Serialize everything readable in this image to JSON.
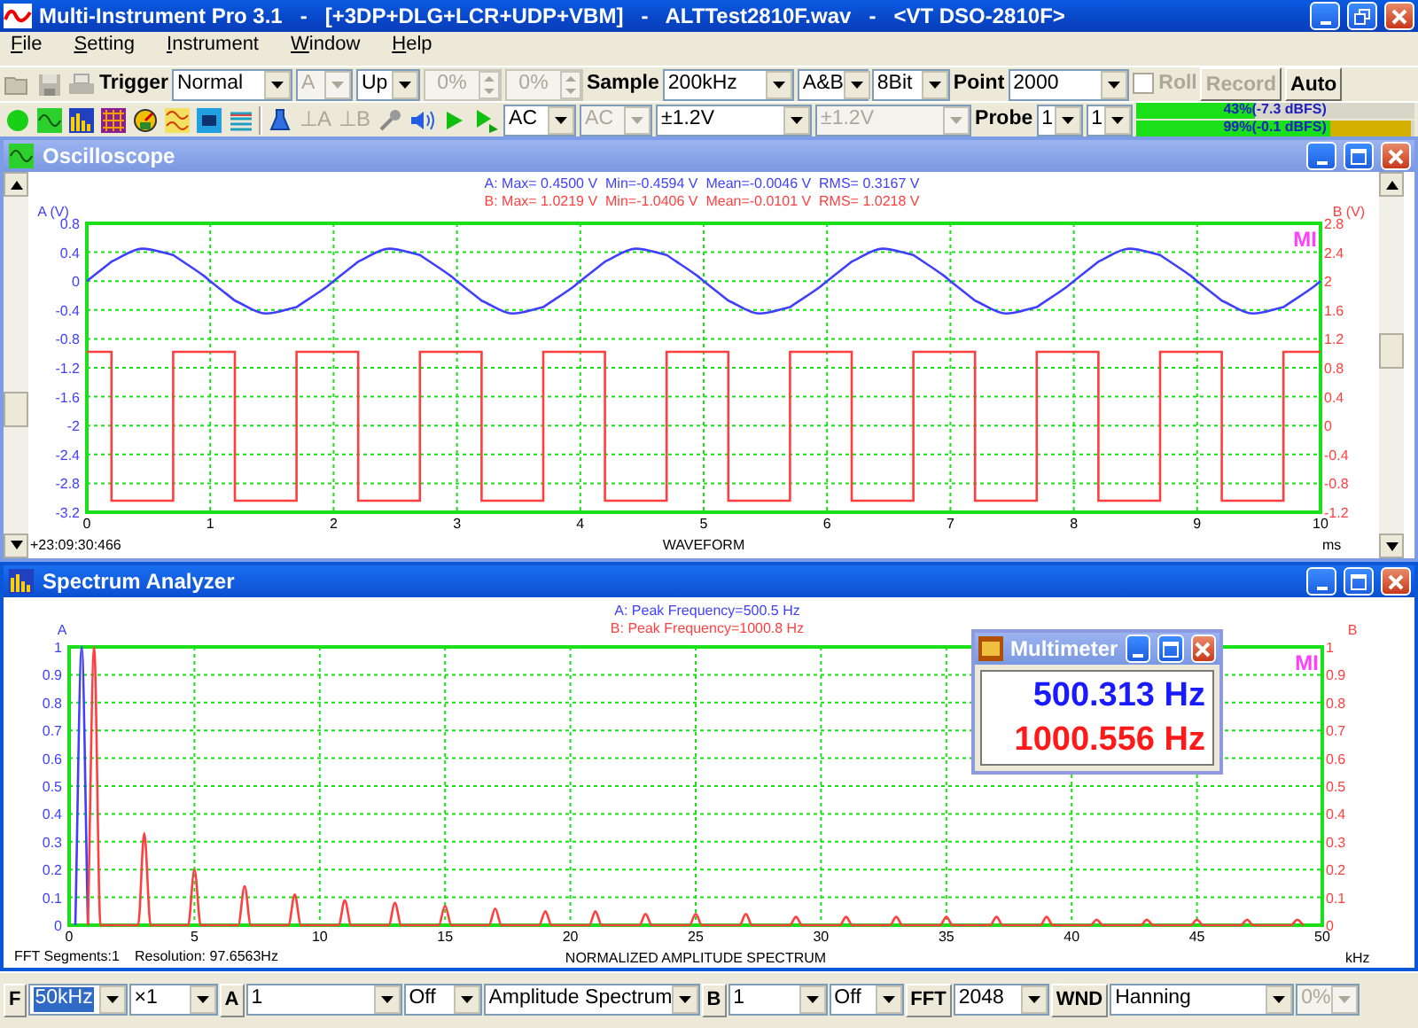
{
  "window": {
    "title": "Multi-Instrument Pro 3.1   -   [+3DP+DLG+LCR+UDP+VBM]   -   ALTTest2810F.wav   -   <VT DSO-2810F>"
  },
  "menu": [
    "File",
    "Setting",
    "Instrument",
    "Window",
    "Help"
  ],
  "toolbar_1": [
    {
      "kind": "label",
      "text": "Trigger"
    },
    {
      "kind": "dropdown",
      "text": "Normal",
      "disabled": false
    },
    {
      "kind": "dropdown",
      "text": "A",
      "disabled": true
    },
    {
      "kind": "dropdown",
      "text": "Up",
      "disabled": false
    },
    {
      "kind": "spin",
      "text": "0%",
      "disabled": true
    },
    {
      "kind": "spin",
      "text": "0%",
      "disabled": true
    },
    {
      "kind": "label",
      "text": "Sample"
    },
    {
      "kind": "dropdown",
      "text": "200kHz",
      "disabled": false
    },
    {
      "kind": "dropdown",
      "text": "A&B",
      "disabled": false
    },
    {
      "kind": "dropdown",
      "text": "8Bit",
      "disabled": false
    },
    {
      "kind": "label",
      "text": "Point"
    },
    {
      "kind": "dropdown",
      "text": "2000",
      "disabled": false
    },
    {
      "kind": "checkbox",
      "text": "Roll",
      "checked": false,
      "disabled": true
    },
    {
      "kind": "button",
      "text": "Record",
      "disabled": true
    },
    {
      "kind": "button",
      "text": "Auto",
      "disabled": false
    }
  ],
  "marker_buttons": [
    {
      "text": "⊥A",
      "disabled": true
    },
    {
      "text": "⊥B",
      "disabled": true
    }
  ],
  "toolbar_2": [
    {
      "kind": "dropdown",
      "text": "AC",
      "disabled": false
    },
    {
      "kind": "dropdown",
      "text": "AC",
      "disabled": true
    },
    {
      "kind": "dropdown",
      "text": "±1.2V",
      "disabled": false
    },
    {
      "kind": "dropdown",
      "text": "±1.2V",
      "disabled": true
    },
    {
      "kind": "label",
      "text": "Probe"
    },
    {
      "kind": "dropdown",
      "text": "1",
      "disabled": false
    },
    {
      "kind": "dropdown",
      "text": "1",
      "disabled": false
    },
    {
      "kind": "meters",
      "meters": [
        {
          "level": 0.43,
          "reading": "43%(-7.3 dBFS)"
        },
        {
          "level": 0.99,
          "reading": "99%(-0.1 dBFS)"
        }
      ]
    }
  ],
  "oscilloscope": {
    "title": "Oscilloscope",
    "active": false,
    "readouts": [
      {
        "text": "A: Max= 0.4500 V  Min=-0.4594 V  Mean=-0.0046 V  RMS= 0.3167 V",
        "color": "#3f3fff"
      },
      {
        "text": "B: Max= 1.0219 V  Min=-1.0406 V  Mean=-0.0101 V  RMS= 1.0218 V",
        "color": "#ff3f3f"
      }
    ],
    "timestamp": "+23:09:30:466",
    "logo": "MI",
    "x_unit": "ms",
    "chart_data": {
      "type": "line",
      "grid": true,
      "xlabel": "WAVEFORM",
      "ylabel": "A (V)",
      "y2label": "B (V)",
      "xlim": [
        0,
        10
      ],
      "ylim": [
        -3.2,
        0.8
      ],
      "y2lim": [
        -1.2,
        2.8
      ],
      "xticks": [
        0,
        1,
        2,
        3,
        4,
        5,
        6,
        7,
        8,
        9,
        10
      ],
      "yticks": [
        0.8,
        0.4,
        0,
        -0.4,
        -0.8,
        -1.2,
        -1.6,
        -2,
        -2.4,
        -2.8,
        -3.2
      ],
      "y2ticks": [
        2.8,
        2.4,
        2,
        1.6,
        1.2,
        0.8,
        0.4,
        0,
        -0.4,
        -0.8,
        -1.2
      ],
      "x": [
        0,
        0.2,
        0.2,
        0.45,
        0.7,
        0.7,
        0.95,
        1,
        1.2,
        1.2,
        1.45,
        1.7,
        1.7,
        1.95,
        2,
        2.2,
        2.2,
        2.45,
        2.7,
        2.7,
        2.95,
        3,
        3.2,
        3.2,
        3.45,
        3.7,
        3.7,
        3.95,
        4,
        4.2,
        4.2,
        4.45,
        4.7,
        4.7,
        4.95,
        5,
        5.2,
        5.2,
        5.45,
        5.7,
        5.7,
        5.95,
        6,
        6.2,
        6.2,
        6.45,
        6.7,
        6.7,
        6.95,
        7,
        7.2,
        7.2,
        7.45,
        7.7,
        7.7,
        7.95,
        8,
        8.2,
        8.2,
        8.45,
        8.7,
        8.7,
        8.95,
        9,
        9.2,
        9.2,
        9.45,
        9.7,
        9.7,
        9.95,
        10
      ],
      "series": [
        {
          "color": "#3f3fff",
          "values": [
            0,
            0.27,
            0.27,
            0.45,
            0.36,
            0.36,
            0.07,
            0,
            -0.27,
            -0.27,
            -0.45,
            -0.36,
            -0.36,
            -0.07,
            0,
            0.27,
            0.27,
            0.45,
            0.36,
            0.36,
            0.07,
            0,
            -0.27,
            -0.27,
            -0.45,
            -0.36,
            -0.36,
            -0.07,
            0,
            0.27,
            0.27,
            0.45,
            0.36,
            0.36,
            0.07,
            0,
            -0.27,
            -0.27,
            -0.45,
            -0.36,
            -0.36,
            -0.07,
            0,
            0.27,
            0.27,
            0.45,
            0.36,
            0.36,
            0.07,
            0,
            -0.27,
            -0.27,
            -0.45,
            -0.36,
            -0.36,
            -0.07,
            0,
            0.27,
            0.27,
            0.45,
            0.36,
            0.36,
            0.07,
            0,
            -0.27,
            -0.27,
            -0.45,
            -0.36,
            -0.36,
            -0.07,
            0
          ]
        },
        {
          "color": "#ff3f3f",
          "axis": "y2",
          "values": [
            1.02,
            1.02,
            -1.04,
            -1.04,
            -1.04,
            1.02,
            1.02,
            1.02,
            1.02,
            -1.04,
            -1.04,
            -1.04,
            1.02,
            1.02,
            1.02,
            1.02,
            -1.04,
            -1.04,
            -1.04,
            1.02,
            1.02,
            1.02,
            1.02,
            -1.04,
            -1.04,
            -1.04,
            1.02,
            1.02,
            1.02,
            1.02,
            -1.04,
            -1.04,
            -1.04,
            1.02,
            1.02,
            1.02,
            1.02,
            -1.04,
            -1.04,
            -1.04,
            1.02,
            1.02,
            1.02,
            1.02,
            -1.04,
            -1.04,
            -1.04,
            1.02,
            1.02,
            1.02,
            1.02,
            -1.04,
            -1.04,
            -1.04,
            1.02,
            1.02,
            1.02,
            1.02,
            -1.04,
            -1.04,
            -1.04,
            1.02,
            1.02,
            1.02,
            1.02,
            -1.04,
            -1.04,
            -1.04,
            1.02,
            1.02,
            1.02
          ]
        }
      ]
    }
  },
  "spectrum": {
    "title": "Spectrum Analyzer",
    "active": true,
    "readouts": [
      {
        "text": "A: Peak Frequency=500.5 Hz",
        "color": "#3f3fff"
      },
      {
        "text": "B: Peak Frequency=1000.8 Hz",
        "color": "#ff3f3f"
      }
    ],
    "logo": "MI",
    "x_unit": "kHz",
    "footer": [
      "FFT Segments:1",
      "Resolution: 97.6563Hz"
    ],
    "chart_data": {
      "type": "line",
      "grid": true,
      "xlabel": "NORMALIZED AMPLITUDE SPECTRUM",
      "ylabel": "A",
      "y2label": "B",
      "xlim": [
        0,
        50
      ],
      "ylim": [
        0,
        1
      ],
      "y2lim": [
        0,
        1
      ],
      "xticks": [
        0,
        5,
        10,
        15,
        20,
        25,
        30,
        35,
        40,
        45,
        50
      ],
      "yticks": [
        0,
        0.1,
        0.2,
        0.3,
        0.4,
        0.5,
        0.6,
        0.7,
        0.8,
        0.9,
        1
      ],
      "y2ticks": [
        0,
        0.1,
        0.2,
        0.3,
        0.4,
        0.5,
        0.6,
        0.7,
        0.8,
        0.9,
        1
      ],
      "x": [
        0.25,
        0.5,
        0.75,
        0.75,
        1,
        1.25,
        2.75,
        3,
        3.25,
        4.75,
        5,
        5.25,
        6.75,
        7,
        7.25,
        8.75,
        9,
        9.25,
        10.75,
        11,
        11.25,
        12.75,
        13,
        13.25,
        14.75,
        15,
        15.25,
        16.75,
        17,
        17.25,
        18.75,
        19,
        19.25,
        20.75,
        21,
        21.25,
        22.75,
        23,
        23.25,
        24.75,
        25,
        25.25,
        26.75,
        27,
        27.25,
        28.75,
        29,
        29.25,
        30.75,
        31,
        31.25,
        32.75,
        33,
        33.25,
        34.75,
        35,
        35.25,
        36.75,
        37,
        37.25,
        38.75,
        39,
        39.25,
        40.75,
        41,
        41.25,
        42.75,
        43,
        43.25,
        44.75,
        45,
        45.25,
        46.75,
        47,
        47.25,
        48.75,
        49,
        49.25
      ],
      "series": [
        {
          "color": "#3f3fff",
          "values": [
            0,
            1,
            0,
            null,
            null,
            null,
            null,
            null,
            null,
            null,
            null,
            null,
            null,
            null,
            null,
            null,
            null,
            null,
            null,
            null,
            null,
            null,
            null,
            null,
            null,
            null,
            null,
            null,
            null,
            null,
            null,
            null,
            null,
            null,
            null,
            null,
            null,
            null,
            null,
            null,
            null,
            null,
            null,
            null,
            null,
            null,
            null,
            null,
            null,
            null,
            null,
            null,
            null,
            null,
            null,
            null,
            null,
            null,
            null,
            null,
            null,
            null,
            null,
            null,
            null,
            null,
            null,
            null,
            null,
            null,
            null,
            null,
            null,
            null,
            null,
            null,
            null,
            null
          ]
        },
        {
          "color": "#ff3f3f",
          "values": [
            null,
            null,
            null,
            0,
            1,
            0,
            0,
            0.33,
            0,
            0,
            0.2,
            0,
            0,
            0.14,
            0,
            0,
            0.11,
            0,
            0,
            0.09,
            0,
            0,
            0.08,
            0,
            0,
            0.07,
            0,
            0,
            0.06,
            0,
            0,
            0.05,
            0,
            0,
            0.05,
            0,
            0,
            0.04,
            0,
            0,
            0.04,
            0,
            0,
            0.04,
            0,
            0,
            0.03,
            0,
            0,
            0.03,
            0,
            0,
            0.03,
            0,
            0,
            0.03,
            0,
            0,
            0.03,
            0,
            0,
            0.03,
            0,
            0,
            0.02,
            0,
            0,
            0.02,
            0,
            0,
            0.02,
            0,
            0,
            0.02,
            0,
            0,
            0.02,
            0
          ]
        }
      ]
    }
  },
  "multimeter": {
    "title": "Multimeter",
    "active": false,
    "readings": [
      {
        "text": "500.313 Hz",
        "color": "#1a1aff"
      },
      {
        "text": "1000.556 Hz",
        "color": "#ff1a1a"
      }
    ]
  },
  "bottom_toolbar": [
    {
      "kind": "boxlabel",
      "text": "F"
    },
    {
      "kind": "dropdown",
      "text": "50kHz",
      "disabled": false,
      "focused": true
    },
    {
      "kind": "dropdown",
      "text": "×1",
      "disabled": false,
      "focused": false
    },
    {
      "kind": "boxlabel",
      "text": "A"
    },
    {
      "kind": "dropdown",
      "text": "1",
      "disabled": false,
      "focused": false
    },
    {
      "kind": "dropdown",
      "text": "Off",
      "disabled": false,
      "focused": false
    },
    {
      "kind": "dropdown",
      "text": "Amplitude Spectrum",
      "disabled": false,
      "focused": false
    },
    {
      "kind": "boxlabel",
      "text": "B"
    },
    {
      "kind": "dropdown",
      "text": "1",
      "disabled": false,
      "focused": false
    },
    {
      "kind": "dropdown",
      "text": "Off",
      "disabled": false,
      "focused": false
    },
    {
      "kind": "boxlabel",
      "text": "FFT"
    },
    {
      "kind": "dropdown",
      "text": "2048",
      "disabled": false,
      "focused": false
    },
    {
      "kind": "boxlabel",
      "text": "WND"
    },
    {
      "kind": "dropdown",
      "text": "Hanning",
      "disabled": false,
      "focused": false
    },
    {
      "kind": "dropdown",
      "text": "0%",
      "disabled": true,
      "focused": false
    }
  ]
}
